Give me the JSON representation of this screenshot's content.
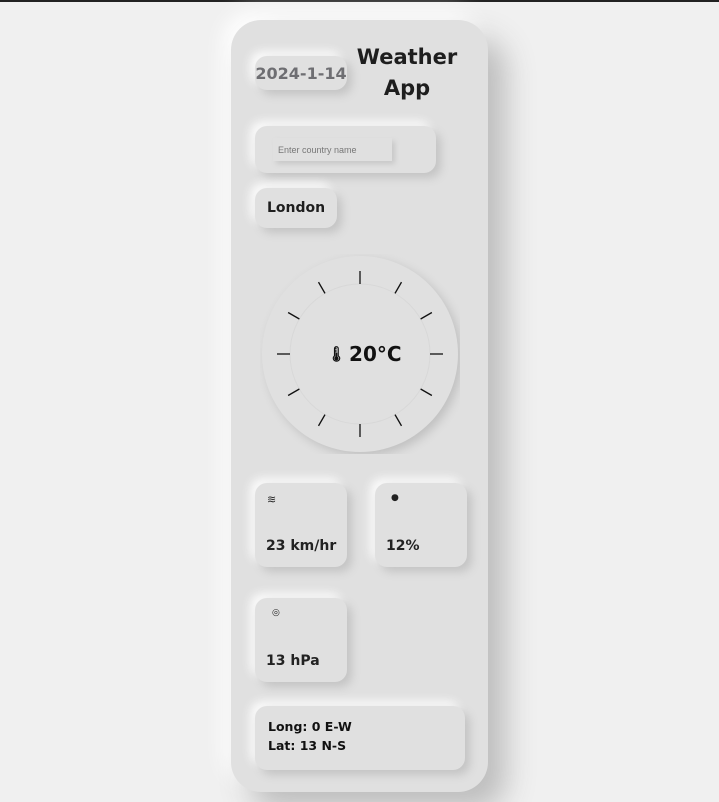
{
  "header": {
    "date": "2024-1-14",
    "title": "Weather App"
  },
  "search": {
    "placeholder": "Enter country name",
    "value": ""
  },
  "city": "London",
  "temperature": {
    "value": "20°C",
    "icon": "thermometer-icon"
  },
  "stats": {
    "wind": {
      "icon": "wind-icon",
      "value": "23 km/hr"
    },
    "humidity": {
      "icon": "droplet-icon",
      "value": "12%"
    },
    "pressure": {
      "icon": "gauge-icon",
      "value": "13 hPa"
    }
  },
  "coords": {
    "long": "Long: 0 E-W",
    "lat": "Lat: 13 N-S"
  }
}
